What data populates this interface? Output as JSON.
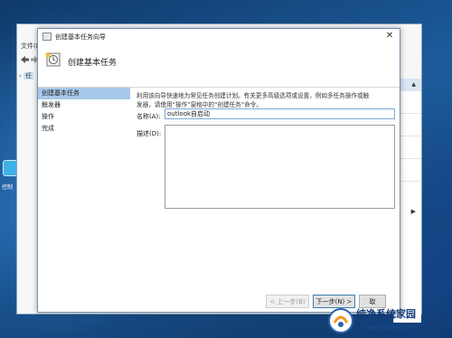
{
  "background_window": {
    "menu_label": "文件(F",
    "tree_item_label": "任"
  },
  "desktop": {
    "icon_label": "控制"
  },
  "dialog": {
    "title": "创建基本任务向导",
    "header_title": "创建基本任务",
    "steps": [
      {
        "label": "创建基本任务",
        "active": true
      },
      {
        "label": "触发器",
        "active": false
      },
      {
        "label": "操作",
        "active": false
      },
      {
        "label": "完成",
        "active": false
      }
    ],
    "description": "利用该向导快速地为常见任务创建计划。有关更多高级选项或设置，例如多任务操作或触发器，请使用“操作”窗格中的“创建任务”命令。",
    "name_label": "名称(A):",
    "name_value": "outlook自启动",
    "description_label": "描述(D):",
    "description_value": "",
    "buttons": {
      "back": "< 上一步(B)",
      "next": "下一步(N) >",
      "cancel": "取"
    }
  },
  "watermark": {
    "text": "纯净系统家园",
    "url": "www.yidaimei.com"
  },
  "colors": {
    "active_step": "#a8c8ea",
    "input_focus_border": "#7aa7d8",
    "desktop": "#1d5c9c"
  }
}
